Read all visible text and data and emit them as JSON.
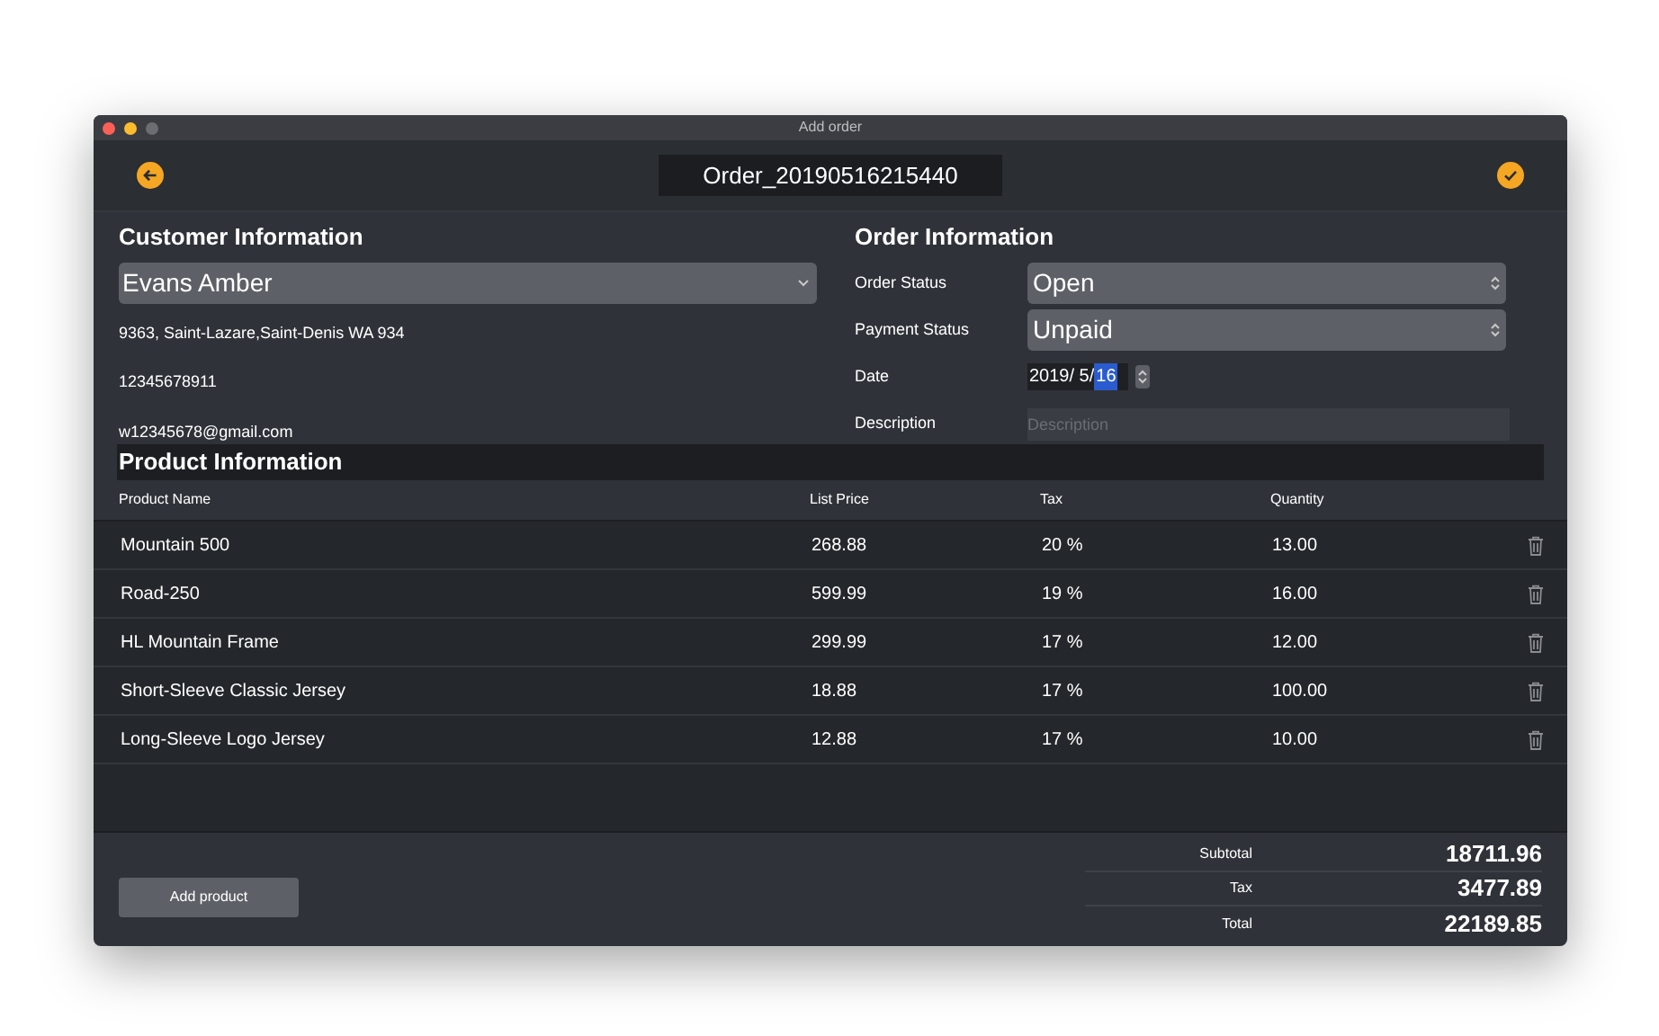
{
  "window": {
    "title": "Add order"
  },
  "toolbar": {
    "order_name": "Order_20190516215440"
  },
  "customer": {
    "heading": "Customer Information",
    "name": "Evans Amber",
    "address": "9363, Saint-Lazare,Saint-Denis WA 934",
    "phone": "12345678911",
    "email": "w12345678@gmail.com"
  },
  "order": {
    "heading": "Order Information",
    "fields": [
      {
        "kind": "select",
        "label": "Order Status",
        "value": "Open"
      },
      {
        "kind": "select",
        "label": "Payment Status",
        "value": "Unpaid"
      },
      {
        "kind": "date",
        "label": "Date",
        "value": "2019/ 5/",
        "highlighted": "16"
      },
      {
        "kind": "text",
        "label": "Description",
        "placeholder": "Description"
      }
    ]
  },
  "products": {
    "heading": "Product Information",
    "columns": [
      "Product Name",
      "List Price",
      "Tax",
      "Quantity"
    ],
    "rows": [
      [
        "Mountain 500",
        "268.88",
        "20 %",
        "13.00"
      ],
      [
        "Road-250",
        "599.99",
        "19 %",
        "16.00"
      ],
      [
        "HL Mountain Frame",
        "299.99",
        "17 %",
        "12.00"
      ],
      [
        "Short-Sleeve Classic Jersey",
        "18.88",
        "17 %",
        "100.00"
      ],
      [
        "Long-Sleeve Logo Jersey",
        "12.88",
        "17 %",
        "10.00"
      ]
    ]
  },
  "footer": {
    "button": "Add product",
    "totals": [
      {
        "label": "Subtotal",
        "value": "18711.96"
      },
      {
        "label": "Tax",
        "value": "3477.89"
      },
      {
        "label": "Total",
        "value": "22189.85"
      }
    ]
  }
}
